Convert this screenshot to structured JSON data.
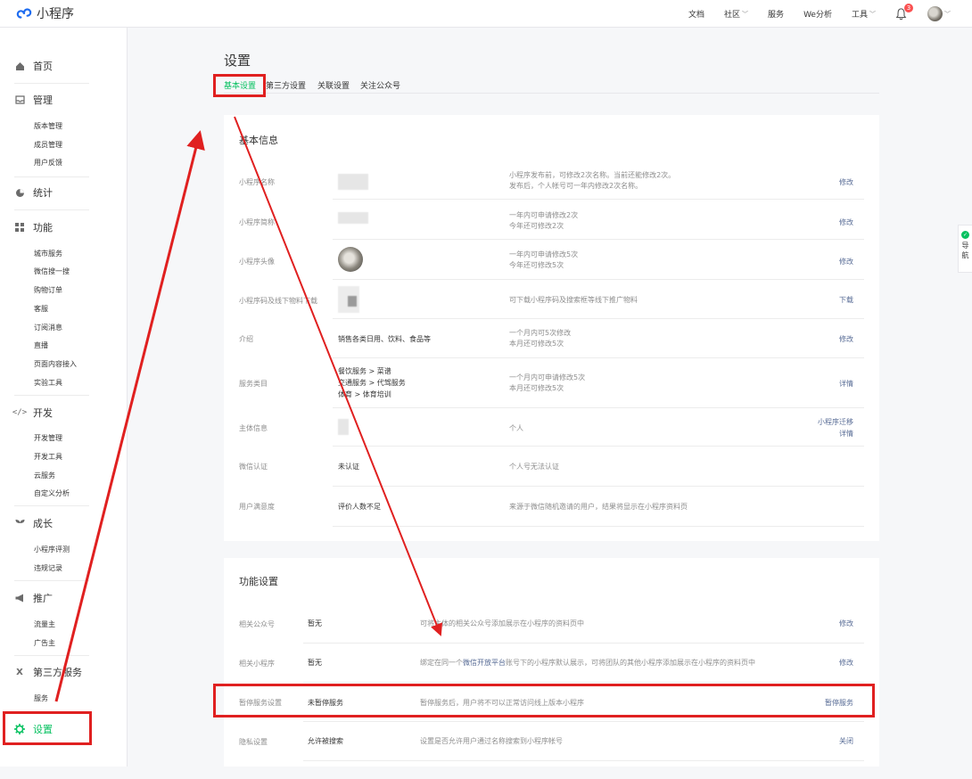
{
  "app": {
    "title": "小程序"
  },
  "topnav": {
    "docs": "文档",
    "community": "社区",
    "services": "服务",
    "we_analytics": "We分析",
    "tools": "工具",
    "notification_count": "3"
  },
  "sidebar": {
    "home": "首页",
    "manage": {
      "label": "管理",
      "items": [
        "版本管理",
        "成员管理",
        "用户反馈"
      ]
    },
    "stats": "统计",
    "features": {
      "label": "功能",
      "items": [
        "城市服务",
        "微信搜一搜",
        "购物订单",
        "客服",
        "订阅消息",
        "直播",
        "页面内容接入",
        "实验工具"
      ]
    },
    "dev": {
      "label": "开发",
      "items": [
        "开发管理",
        "开发工具",
        "云服务",
        "自定义分析"
      ]
    },
    "growth": {
      "label": "成长",
      "items": [
        "小程序评测",
        "违规记录"
      ]
    },
    "promo": {
      "label": "推广",
      "items": [
        "流量主",
        "广告主"
      ]
    },
    "third_party": {
      "label": "第三方服务",
      "items": [
        "服务"
      ]
    },
    "settings": "设置"
  },
  "main": {
    "title": "设置",
    "tabs": [
      "基本设置",
      "第三方设置",
      "关联设置",
      "关注公众号"
    ]
  },
  "basic_info": {
    "title": "基本信息",
    "rows": [
      {
        "label": "小程序名称",
        "value": "",
        "desc": [
          "小程序发布前，可修改2次名称。当前还能修改2次。",
          "发布后，个人帐号可一年内修改2次名称。"
        ],
        "action": "修改"
      },
      {
        "label": "小程序简称",
        "value": "",
        "desc": [
          "一年内可申请修改2次",
          "今年还可修改2次"
        ],
        "action": "修改"
      },
      {
        "label": "小程序头像",
        "value": "",
        "desc": [
          "一年内可申请修改5次",
          "今年还可修改5次"
        ],
        "action": "修改"
      },
      {
        "label": "小程序码及线下物料下载",
        "value": "",
        "desc": [
          "可下载小程序码及搜索框等线下推广物料"
        ],
        "action": "下载"
      },
      {
        "label": "介绍",
        "value": "销售各类日用、饮料、食品等",
        "desc": [
          "一个月内可5次修改",
          "本月还可修改5次"
        ],
        "action": "修改"
      },
      {
        "label": "服务类目",
        "value": [
          "餐饮服务 > 菜谱",
          "交通服务 > 代驾服务",
          "体育 > 体育培训"
        ],
        "desc": [
          "一个月内可申请修改5次",
          "本月还可修改5次"
        ],
        "action": "详情"
      },
      {
        "label": "主体信息",
        "value": "",
        "desc": [
          "个人"
        ],
        "action": [
          "小程序迁移",
          "详情"
        ]
      },
      {
        "label": "微信认证",
        "value": "未认证",
        "desc": [
          "个人号无法认证"
        ],
        "action": ""
      },
      {
        "label": "用户满意度",
        "value": "评价人数不足",
        "desc": [
          "来源于微信随机邀请的用户，结果将显示在小程序资料页"
        ],
        "action": ""
      }
    ]
  },
  "feature_settings": {
    "title": "功能设置",
    "rows": [
      {
        "label": "相关公众号",
        "value": "暂无",
        "desc": "可将主体的相关公众号添加展示在小程序的资料页中",
        "action": "修改"
      },
      {
        "label": "相关小程序",
        "value": "暂无",
        "desc_pre": "绑定在同一个",
        "desc_link": "微信开放平台",
        "desc_post": "账号下的小程序默认展示，可将团队的其他小程序添加展示在小程序的资料页中",
        "action": "修改"
      },
      {
        "label": "暂停服务设置",
        "value": "未暂停服务",
        "desc": "暂停服务后，用户将不可以正常访问线上版本小程序",
        "action": "暂停服务"
      },
      {
        "label": "隐私设置",
        "value": "允许被搜索",
        "desc": "设置是否允许用户通过名称搜索到小程序帐号",
        "action": "关闭"
      }
    ]
  },
  "side_float": {
    "label": "导航"
  },
  "colors": {
    "accent": "#07c160",
    "link": "#576b95",
    "annotation": "#e02020"
  }
}
